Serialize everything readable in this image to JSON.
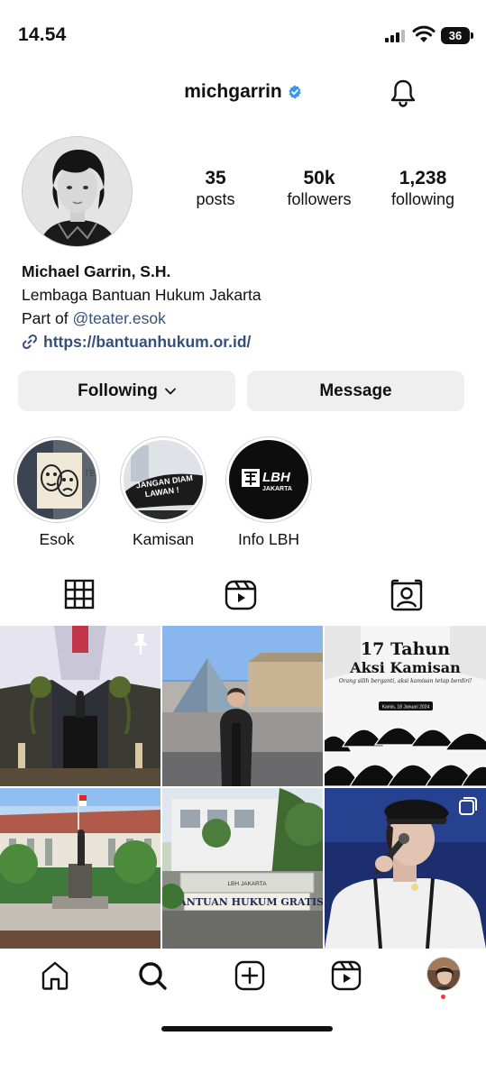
{
  "status_bar": {
    "time": "14.54",
    "battery": "36"
  },
  "header": {
    "username": "michgarrin",
    "verified": true
  },
  "profile": {
    "stats": [
      {
        "value": "35",
        "label": "posts"
      },
      {
        "value": "50k",
        "label": "followers"
      },
      {
        "value": "1,238",
        "label": "following"
      }
    ],
    "display_name": "Michael Garrin, S.H.",
    "bio_line1": "Lembaga Bantuan Hukum Jakarta",
    "bio_part_of": "Part of",
    "bio_mention": "@teater.esok",
    "website": "https://bantuanhukum.or.id/"
  },
  "buttons": {
    "following": "Following",
    "message": "Message"
  },
  "highlights": [
    {
      "label": "Esok",
      "cover_text": ""
    },
    {
      "label": "Kamisan",
      "cover_text": "JANGAN DIAM LAWAN !"
    },
    {
      "label": "Info LBH",
      "cover_text": "LBH JAKARTA"
    }
  ],
  "tabs": [
    "grid-icon",
    "reels-icon",
    "tagged-icon"
  ],
  "posts": [
    {
      "id": "post-1",
      "pinned": true,
      "overlay_text": ""
    },
    {
      "id": "post-2",
      "pinned": false,
      "overlay_text": ""
    },
    {
      "id": "post-3",
      "pinned": false,
      "overlay_text": "17 Tahun Aksi Kamisan",
      "overlay_sub": "Orang silih berganti, aksi kamisan tetap berdiri!",
      "overlay_date": "Kamis, 18 Januari 2024"
    },
    {
      "id": "post-4",
      "pinned": false,
      "overlay_text": ""
    },
    {
      "id": "post-5",
      "pinned": false,
      "overlay_text": "BANTUAN HUKUM GRATIS",
      "overlay_sub": "LBH JAKARTA"
    },
    {
      "id": "post-6",
      "pinned": false,
      "multi": true,
      "overlay_text": ""
    }
  ],
  "bottom_nav": [
    "home-icon",
    "search-icon",
    "create-icon",
    "reels-icon",
    "profile-avatar"
  ],
  "colors": {
    "link": "#37507a",
    "verified": "#3897f0",
    "button_bg": "#efefef",
    "notification_dot": "#ff3040"
  }
}
